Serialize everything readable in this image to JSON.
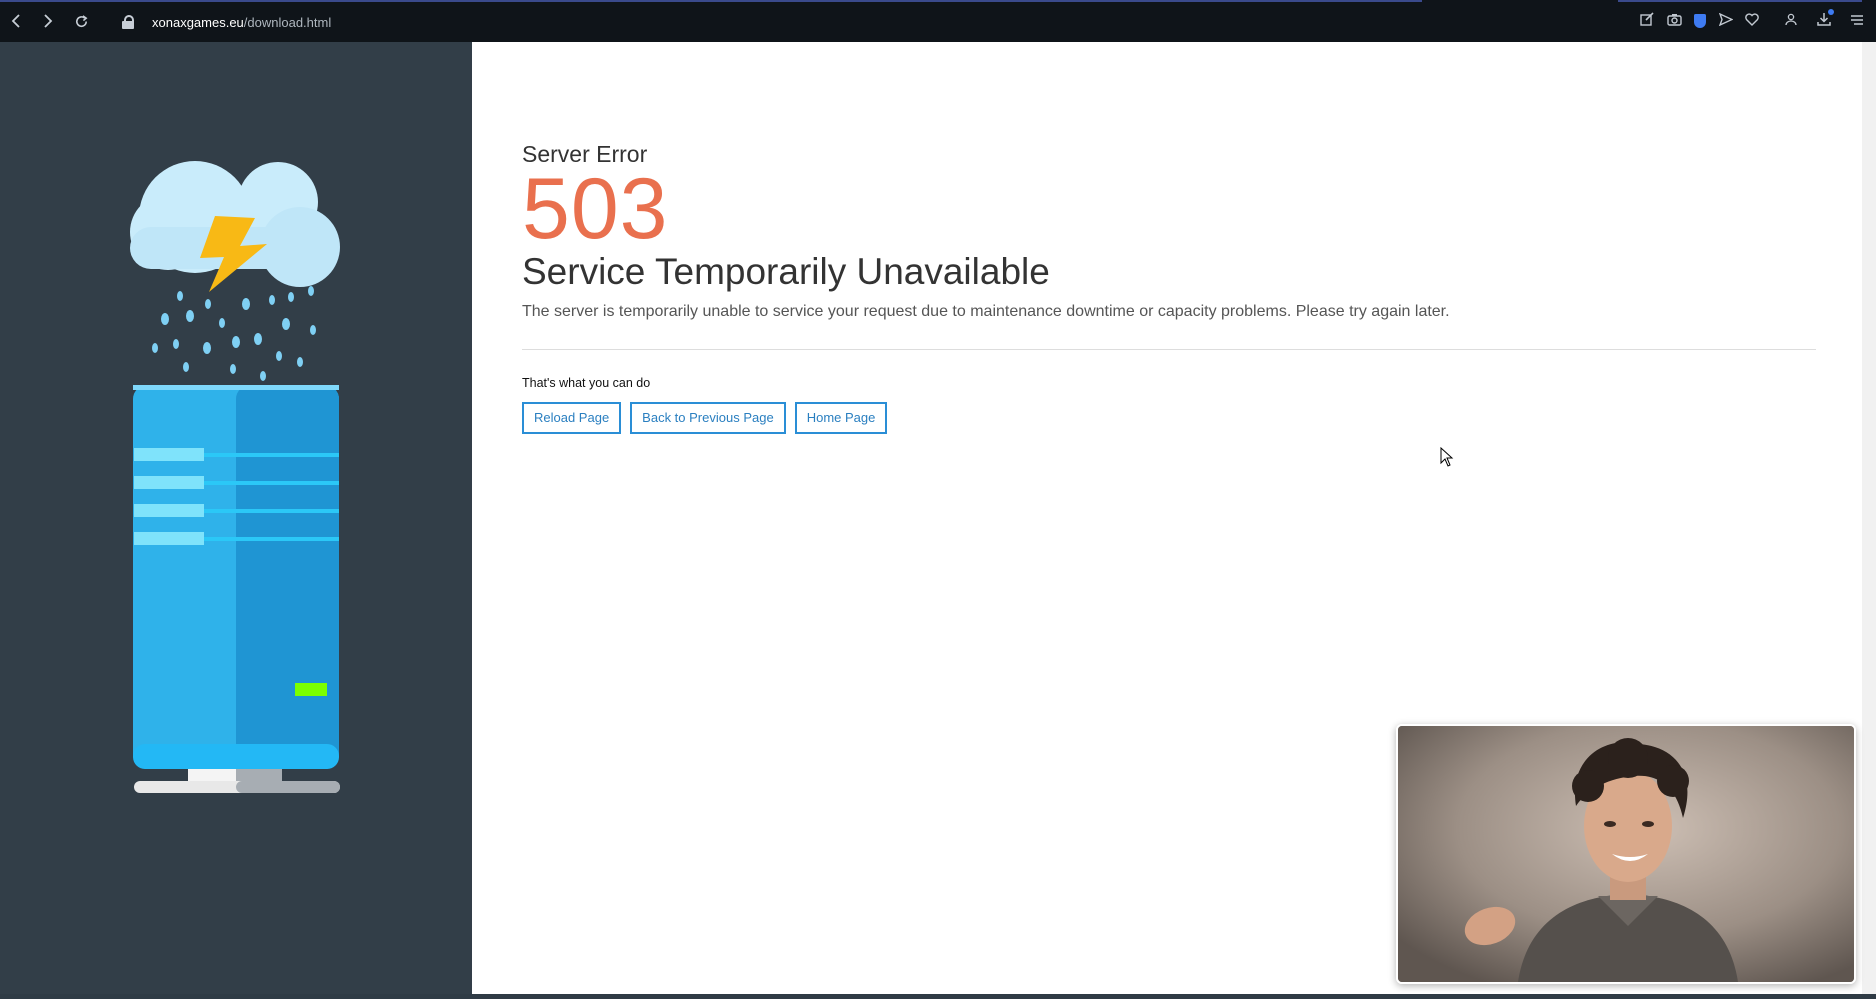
{
  "browser": {
    "url_host": "xonaxgames.eu",
    "url_path": "/download.html",
    "icons": [
      "back-icon",
      "forward-icon",
      "reload-icon",
      "lock-icon",
      "edit-icon",
      "camera-icon",
      "shield-icon",
      "send-icon",
      "heart-icon",
      "profile-icon",
      "download-icon",
      "menu-icon"
    ]
  },
  "error": {
    "title": "Server Error",
    "code": "503",
    "heading": "Service Temporarily Unavailable",
    "description": "The server is temporarily unable to service your request due to maintenance downtime or capacity problems. Please try again later.",
    "actions_label": "That's what you can do",
    "buttons": [
      "Reload Page",
      "Back to Previous Page",
      "Home Page"
    ]
  },
  "colors": {
    "code": "#e9704e",
    "button_border": "#2a8ed6",
    "left_panel": "#323e48",
    "server_led": "#7bff00"
  }
}
